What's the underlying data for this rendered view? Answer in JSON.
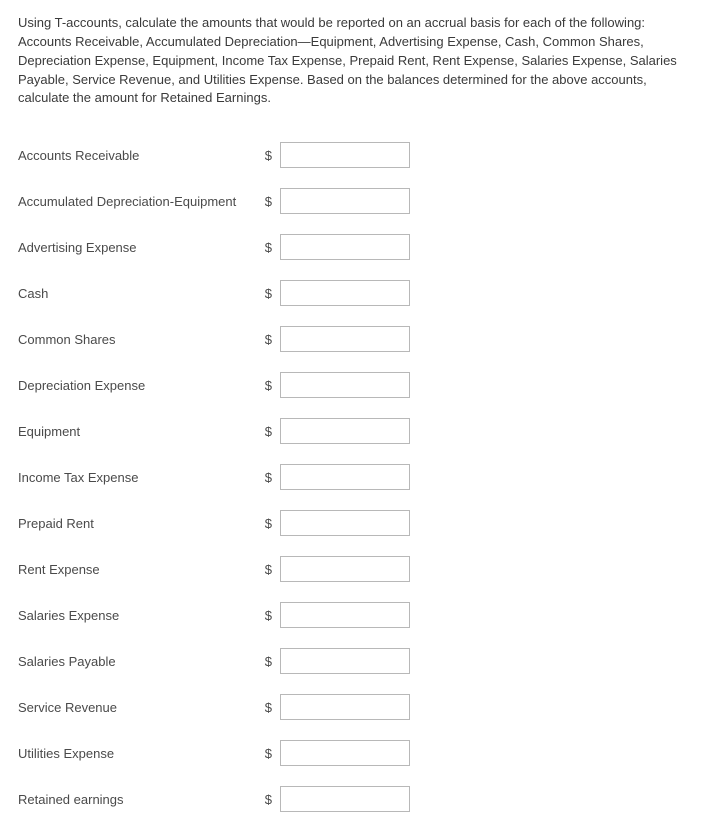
{
  "instructions": "Using T-accounts, calculate the amounts that would be reported on an accrual basis for each of the following: Accounts Receivable, Accumulated Depreciation—Equipment, Advertising Expense, Cash, Common Shares, Depreciation Expense, Equipment, Income Tax Expense, Prepaid Rent, Rent Expense, Salaries Expense, Salaries Payable, Service Revenue, and Utilities Expense. Based on the balances determined for the above accounts, calculate the amount for Retained Earnings.",
  "currency_symbol": "$",
  "rows": [
    {
      "label": "Accounts Receivable",
      "value": ""
    },
    {
      "label": "Accumulated Depreciation-Equipment",
      "value": ""
    },
    {
      "label": "Advertising Expense",
      "value": ""
    },
    {
      "label": "Cash",
      "value": ""
    },
    {
      "label": "Common Shares",
      "value": ""
    },
    {
      "label": "Depreciation Expense",
      "value": ""
    },
    {
      "label": "Equipment",
      "value": ""
    },
    {
      "label": "Income Tax Expense",
      "value": ""
    },
    {
      "label": "Prepaid Rent",
      "value": ""
    },
    {
      "label": "Rent Expense",
      "value": ""
    },
    {
      "label": "Salaries Expense",
      "value": ""
    },
    {
      "label": "Salaries Payable",
      "value": ""
    },
    {
      "label": "Service Revenue",
      "value": ""
    },
    {
      "label": "Utilities Expense",
      "value": ""
    },
    {
      "label": "Retained earnings",
      "value": ""
    }
  ]
}
